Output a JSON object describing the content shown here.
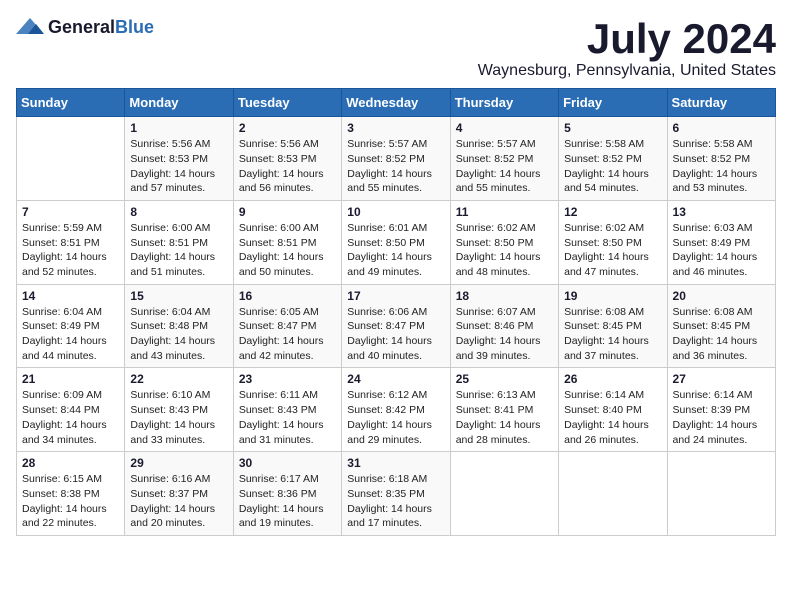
{
  "logo": {
    "general": "General",
    "blue": "Blue"
  },
  "title": "July 2024",
  "subtitle": "Waynesburg, Pennsylvania, United States",
  "days_of_week": [
    "Sunday",
    "Monday",
    "Tuesday",
    "Wednesday",
    "Thursday",
    "Friday",
    "Saturday"
  ],
  "weeks": [
    [
      {
        "day": "",
        "info": ""
      },
      {
        "day": "1",
        "info": "Sunrise: 5:56 AM\nSunset: 8:53 PM\nDaylight: 14 hours\nand 57 minutes."
      },
      {
        "day": "2",
        "info": "Sunrise: 5:56 AM\nSunset: 8:53 PM\nDaylight: 14 hours\nand 56 minutes."
      },
      {
        "day": "3",
        "info": "Sunrise: 5:57 AM\nSunset: 8:52 PM\nDaylight: 14 hours\nand 55 minutes."
      },
      {
        "day": "4",
        "info": "Sunrise: 5:57 AM\nSunset: 8:52 PM\nDaylight: 14 hours\nand 55 minutes."
      },
      {
        "day": "5",
        "info": "Sunrise: 5:58 AM\nSunset: 8:52 PM\nDaylight: 14 hours\nand 54 minutes."
      },
      {
        "day": "6",
        "info": "Sunrise: 5:58 AM\nSunset: 8:52 PM\nDaylight: 14 hours\nand 53 minutes."
      }
    ],
    [
      {
        "day": "7",
        "info": "Sunrise: 5:59 AM\nSunset: 8:51 PM\nDaylight: 14 hours\nand 52 minutes."
      },
      {
        "day": "8",
        "info": "Sunrise: 6:00 AM\nSunset: 8:51 PM\nDaylight: 14 hours\nand 51 minutes."
      },
      {
        "day": "9",
        "info": "Sunrise: 6:00 AM\nSunset: 8:51 PM\nDaylight: 14 hours\nand 50 minutes."
      },
      {
        "day": "10",
        "info": "Sunrise: 6:01 AM\nSunset: 8:50 PM\nDaylight: 14 hours\nand 49 minutes."
      },
      {
        "day": "11",
        "info": "Sunrise: 6:02 AM\nSunset: 8:50 PM\nDaylight: 14 hours\nand 48 minutes."
      },
      {
        "day": "12",
        "info": "Sunrise: 6:02 AM\nSunset: 8:50 PM\nDaylight: 14 hours\nand 47 minutes."
      },
      {
        "day": "13",
        "info": "Sunrise: 6:03 AM\nSunset: 8:49 PM\nDaylight: 14 hours\nand 46 minutes."
      }
    ],
    [
      {
        "day": "14",
        "info": "Sunrise: 6:04 AM\nSunset: 8:49 PM\nDaylight: 14 hours\nand 44 minutes."
      },
      {
        "day": "15",
        "info": "Sunrise: 6:04 AM\nSunset: 8:48 PM\nDaylight: 14 hours\nand 43 minutes."
      },
      {
        "day": "16",
        "info": "Sunrise: 6:05 AM\nSunset: 8:47 PM\nDaylight: 14 hours\nand 42 minutes."
      },
      {
        "day": "17",
        "info": "Sunrise: 6:06 AM\nSunset: 8:47 PM\nDaylight: 14 hours\nand 40 minutes."
      },
      {
        "day": "18",
        "info": "Sunrise: 6:07 AM\nSunset: 8:46 PM\nDaylight: 14 hours\nand 39 minutes."
      },
      {
        "day": "19",
        "info": "Sunrise: 6:08 AM\nSunset: 8:45 PM\nDaylight: 14 hours\nand 37 minutes."
      },
      {
        "day": "20",
        "info": "Sunrise: 6:08 AM\nSunset: 8:45 PM\nDaylight: 14 hours\nand 36 minutes."
      }
    ],
    [
      {
        "day": "21",
        "info": "Sunrise: 6:09 AM\nSunset: 8:44 PM\nDaylight: 14 hours\nand 34 minutes."
      },
      {
        "day": "22",
        "info": "Sunrise: 6:10 AM\nSunset: 8:43 PM\nDaylight: 14 hours\nand 33 minutes."
      },
      {
        "day": "23",
        "info": "Sunrise: 6:11 AM\nSunset: 8:43 PM\nDaylight: 14 hours\nand 31 minutes."
      },
      {
        "day": "24",
        "info": "Sunrise: 6:12 AM\nSunset: 8:42 PM\nDaylight: 14 hours\nand 29 minutes."
      },
      {
        "day": "25",
        "info": "Sunrise: 6:13 AM\nSunset: 8:41 PM\nDaylight: 14 hours\nand 28 minutes."
      },
      {
        "day": "26",
        "info": "Sunrise: 6:14 AM\nSunset: 8:40 PM\nDaylight: 14 hours\nand 26 minutes."
      },
      {
        "day": "27",
        "info": "Sunrise: 6:14 AM\nSunset: 8:39 PM\nDaylight: 14 hours\nand 24 minutes."
      }
    ],
    [
      {
        "day": "28",
        "info": "Sunrise: 6:15 AM\nSunset: 8:38 PM\nDaylight: 14 hours\nand 22 minutes."
      },
      {
        "day": "29",
        "info": "Sunrise: 6:16 AM\nSunset: 8:37 PM\nDaylight: 14 hours\nand 20 minutes."
      },
      {
        "day": "30",
        "info": "Sunrise: 6:17 AM\nSunset: 8:36 PM\nDaylight: 14 hours\nand 19 minutes."
      },
      {
        "day": "31",
        "info": "Sunrise: 6:18 AM\nSunset: 8:35 PM\nDaylight: 14 hours\nand 17 minutes."
      },
      {
        "day": "",
        "info": ""
      },
      {
        "day": "",
        "info": ""
      },
      {
        "day": "",
        "info": ""
      }
    ]
  ]
}
